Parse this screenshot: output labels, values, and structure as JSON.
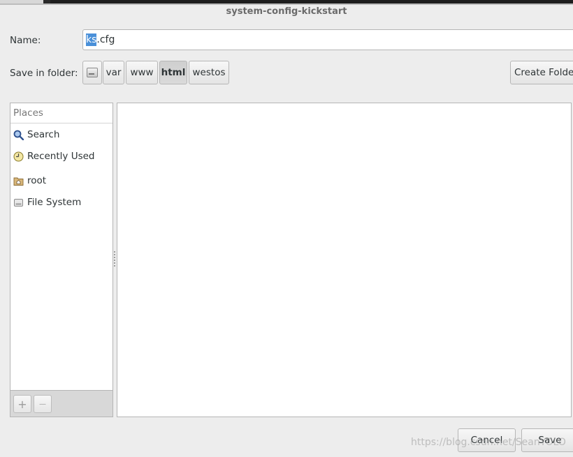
{
  "window": {
    "title": "system-config-kickstart"
  },
  "name_field": {
    "label": "Name:",
    "value_selected": "ks",
    "value_rest": ".cfg"
  },
  "save_in": {
    "label": "Save in folder:",
    "path": [
      "var",
      "www",
      "html",
      "westos"
    ],
    "active": "html"
  },
  "create_folder_label": "Create Folde",
  "places": {
    "header": "Places",
    "items": [
      {
        "label": "Search",
        "icon": "search-icon"
      },
      {
        "label": "Recently Used",
        "icon": "recent-icon"
      },
      {
        "label": "root",
        "icon": "home-folder-icon"
      },
      {
        "label": "File System",
        "icon": "drive-icon"
      }
    ],
    "add_label": "+",
    "remove_label": "—"
  },
  "buttons": {
    "cancel": "Cancel",
    "save": "Save"
  },
  "watermark": "https://blog.csdn.net/SeanYOLO"
}
